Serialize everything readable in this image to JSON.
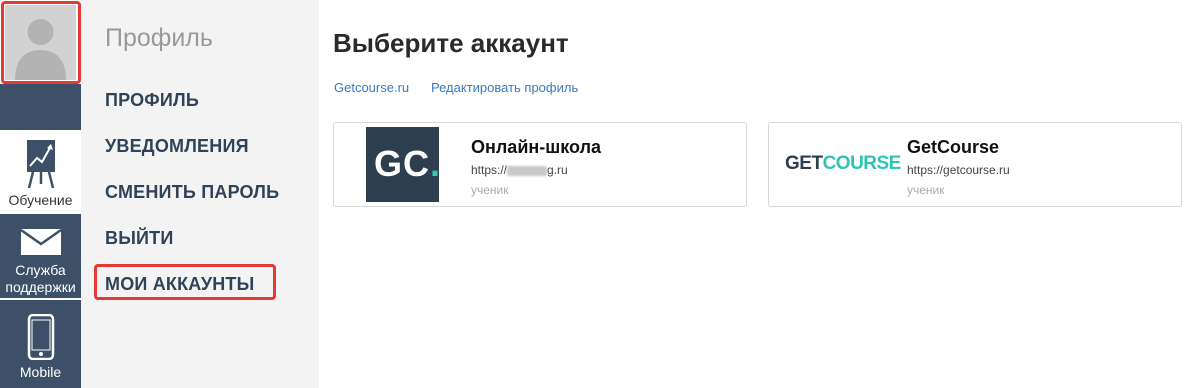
{
  "rail": {
    "learn_label": "Обучение",
    "support_label": "Служба поддержки",
    "mobile_label": "Mobile"
  },
  "menu": {
    "title": "Профиль",
    "items": [
      {
        "label": "ПРОФИЛЬ"
      },
      {
        "label": "УВЕДОМЛЕНИЯ"
      },
      {
        "label": "СМЕНИТЬ ПАРОЛЬ"
      },
      {
        "label": "ВЫЙТИ"
      },
      {
        "label": "МОИ АККАУНТЫ"
      }
    ]
  },
  "main": {
    "title": "Выберите аккаунт",
    "links": [
      {
        "label": "Getcourse.ru"
      },
      {
        "label": "Редактировать профиль"
      }
    ],
    "accounts": [
      {
        "name": "Онлайн-школа",
        "url_prefix": "https://",
        "url_suffix": "g.ru",
        "role": "ученик",
        "logo_text": "GC."
      },
      {
        "name": "GetCourse",
        "url": "https://getcourse.ru",
        "role": "ученик",
        "logo_text": "GETCOURSE"
      }
    ]
  },
  "colors": {
    "rail_blue": "#3d5068",
    "highlight": "#e53935",
    "link": "#3a7bbf",
    "accent_teal": "#2ec4b6"
  }
}
